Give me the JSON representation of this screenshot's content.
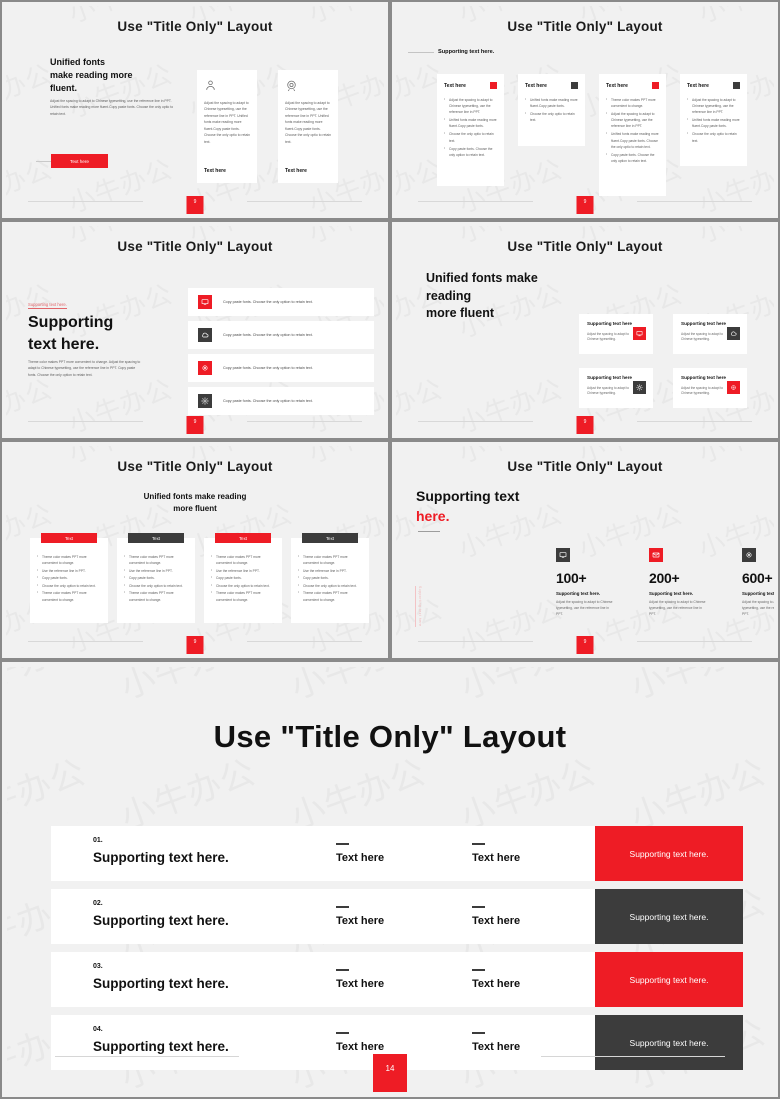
{
  "common": {
    "slide_title": "Use \"Title Only\" Layout",
    "accent_red": "#ee1c25",
    "accent_dark": "#3c3c3c",
    "page_number_small": "9",
    "watermark_text": "小牛办公"
  },
  "slide1": {
    "title": "Use \"Title Only\" Layout",
    "heading": "Unified fonts\nmake reading more\nfluent.",
    "paragraph": "Adjust the spacing to adapt to Chinese typesetting, use the reference line in PPT. Unified fonts make reading more fluent.Copy paste fonts. Choose the only optio to retain text.",
    "button_label": "Text here",
    "cards": [
      {
        "icon": "user-icon",
        "paragraph": "Adjust the spacing to adapt to Chinese typesetting, use the reference line in PPT. Unified fonts make reading more fluent.Copy paste fonts. Choose the only optio to retain text.",
        "label": "Text here"
      },
      {
        "icon": "target-icon",
        "paragraph": "Adjust the spacing to adapt to Chinese typesetting, use the reference line in PPT. Unified fonts make reading more fluent.Copy paste fonts. Choose the only optio to retain text.",
        "label": "Text here"
      }
    ]
  },
  "slide2": {
    "title": "Use \"Title Only\" Layout",
    "supporting": "Supporting text here.",
    "cards": [
      {
        "label": "Text here",
        "swatch": "#ee1c25",
        "bullets": [
          "Adjust the spacing to adapt to Chinese typesetting, use the reference line in PPT.",
          "Unified fonts make reading more fluent.Copy paste fonts.",
          "Choose the only optio to retain text.",
          "Copy paste  fonts. Choose the only option to retain text."
        ]
      },
      {
        "label": "Text here",
        "swatch": "#3c3c3c",
        "bullets": [
          "Unified fonts make reading more fluent.Copy paste fonts.",
          "Choose the only optio to retain text."
        ]
      },
      {
        "label": "Text here",
        "swatch": "#ee1c25",
        "bullets": [
          "Theme  color makes PPT more convenient to change.",
          "Adjust the spacing to adapt to Chinese typesetting, use the reference line in PPT.",
          "Unified fonts make reading more fluent.Copy paste fonts. Choose the only optio to retain text.",
          "Copy paste  fonts. Choose the only option to retain text."
        ]
      },
      {
        "label": "Text here",
        "swatch": "#3c3c3c",
        "bullets": [
          "Adjust the spacing to adapt to Chinese typesetting, use the reference line in PPT.",
          "Unified fonts make reading more fluent.Copy paste fonts.",
          "Choose the only optio to retain text."
        ]
      }
    ]
  },
  "slide3": {
    "title": "Use \"Title Only\" Layout",
    "kicker": "Supporting text here.",
    "heading": "Supporting\ntext here.",
    "paragraph": "Theme color makes PPT more convenient to change. Adjust the spacing to adapt to Chinese typesetting, use the reference line in PPT. Copy paste  fonts. Choose the only option to retain text.",
    "rows": [
      {
        "icon": "monitor-icon",
        "color": "#ee1c25",
        "text": "Copy paste fonts. Choose the only option to retain text."
      },
      {
        "icon": "cloud-icon",
        "color": "#3c3c3c",
        "text": "Copy paste fonts. Choose the only option to retain text."
      },
      {
        "icon": "camera-icon",
        "color": "#ee1c25",
        "text": "Copy paste fonts. Choose the only option to retain text."
      },
      {
        "icon": "gear-icon",
        "color": "#3c3c3c",
        "text": "Copy paste fonts. Choose the only option to retain text."
      }
    ]
  },
  "slide4": {
    "title": "Use \"Title Only\" Layout",
    "heading": "Unified fonts make\nreading\nmore fluent",
    "cards": [
      {
        "title": "Supporting text here",
        "text": "Adjust the spacing to adapt to Chinese typesetting.",
        "icon": "monitor-icon",
        "color": "#ee1c25"
      },
      {
        "title": "Supporting text here",
        "text": "Adjust the spacing to adapt to Chinese typesetting.",
        "icon": "cloud-icon",
        "color": "#3c3c3c"
      },
      {
        "title": "Supporting text here",
        "text": "Adjust the spacing to adapt to Chinese typesetting.",
        "icon": "gear-icon",
        "color": "#3c3c3c"
      },
      {
        "title": "Supporting text here",
        "text": "Adjust the spacing to adapt to Chinese typesetting.",
        "icon": "camera-icon",
        "color": "#ee1c25"
      }
    ]
  },
  "slide5": {
    "title": "Use \"Title Only\" Layout",
    "subtitle": "Unified fonts make reading\nmore fluent",
    "cards": [
      {
        "tag": "Text",
        "tag_color": "#ee1c25",
        "bullets": [
          "Theme  color makes PPT more convenient to change.",
          "Use the reference line in PPT.",
          "Copy paste fonts.",
          "Choose the only option to retain text.",
          "Theme  color makes PPT more convenient to change."
        ]
      },
      {
        "tag": "Text",
        "tag_color": "#3c3c3c",
        "bullets": [
          "Theme  color makes PPT more convenient to change.",
          "Use the reference line in PPT.",
          "Copy paste fonts.",
          "Choose the only option to retain text.",
          "Theme  color makes PPT more convenient to change."
        ]
      },
      {
        "tag": "Text",
        "tag_color": "#ee1c25",
        "bullets": [
          "Theme  color makes PPT more convenient to change.",
          "Use the reference line in PPT.",
          "Copy paste fonts.",
          "Choose the only option to retain text.",
          "Theme  color makes PPT more convenient to change."
        ]
      },
      {
        "tag": "Text",
        "tag_color": "#3c3c3c",
        "bullets": [
          "Theme  color makes PPT more convenient to change.",
          "Use the reference line in PPT.",
          "Copy paste fonts.",
          "Choose the only option to retain text.",
          "Theme  color makes PPT more convenient to change."
        ]
      }
    ]
  },
  "slide6": {
    "title": "Use \"Title Only\" Layout",
    "heading_line1": "Supporting text",
    "heading_line2": "here.",
    "vertical_text": "Supporting text here",
    "stats": [
      {
        "icon": "monitor-icon",
        "color": "#3c3c3c",
        "number": "100+",
        "title": "Supporting text here.",
        "text": "Adjust the spacing to adapt to Chinese typesetting, use the reference line in PPT."
      },
      {
        "icon": "mail-icon",
        "color": "#ee1c25",
        "number": "200+",
        "title": "Supporting text here.",
        "text": "Adjust the spacing to adapt to Chinese typesetting, use the reference line in PPT."
      },
      {
        "icon": "camera-icon",
        "color": "#3c3c3c",
        "number": "600+",
        "title": "Supporting text here.",
        "text": "Adjust the spacing to adapt to Chinese typesetting, use the reference line in PPT."
      }
    ]
  },
  "big_slide": {
    "title": "Use \"Title Only\" Layout",
    "page_number": "14",
    "rows": [
      {
        "num": "01.",
        "main": "Supporting text here.",
        "col2": "Text here",
        "col3": "Text here",
        "panel_text": "Supporting text here.",
        "panel_color": "#ee1c25"
      },
      {
        "num": "02.",
        "main": "Supporting text here.",
        "col2": "Text here",
        "col3": "Text here",
        "panel_text": "Supporting text here.",
        "panel_color": "#3c3c3c"
      },
      {
        "num": "03.",
        "main": "Supporting text here.",
        "col2": "Text here",
        "col3": "Text here",
        "panel_text": "Supporting text here.",
        "panel_color": "#ee1c25"
      },
      {
        "num": "04.",
        "main": "Supporting text here.",
        "col2": "Text here",
        "col3": "Text here",
        "panel_text": "Supporting text here.",
        "panel_color": "#3c3c3c"
      }
    ]
  }
}
